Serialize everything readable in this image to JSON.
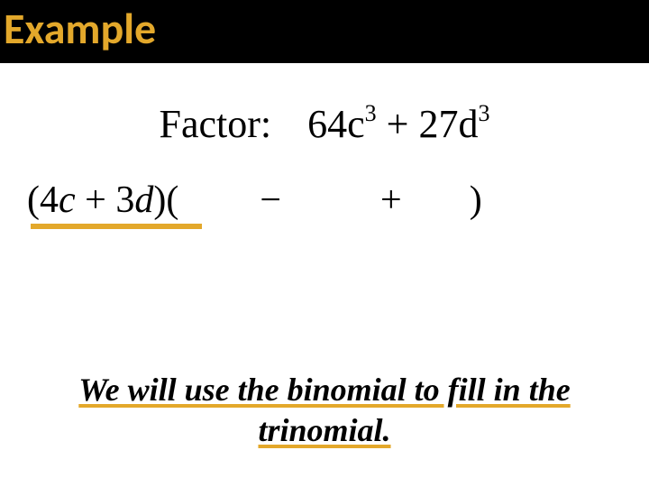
{
  "title": "Example",
  "factor": {
    "label": "Factor:",
    "coef1": "64",
    "var1": "c",
    "exp1": "3",
    "op": "+",
    "coef2": "27",
    "var2": "d",
    "exp2": "3"
  },
  "work": {
    "lparen1": "(",
    "term1_coef": "4",
    "term1_var": "c",
    "op1": "+",
    "term2_coef": "3",
    "term2_var": "d",
    "rparen1": ")",
    "lparen2": "(",
    "op_minus": "−",
    "op_plus": "+",
    "rparen2": ")"
  },
  "caption": {
    "line1": "We will use the binomial to fill in the",
    "line2": "trinomial."
  }
}
